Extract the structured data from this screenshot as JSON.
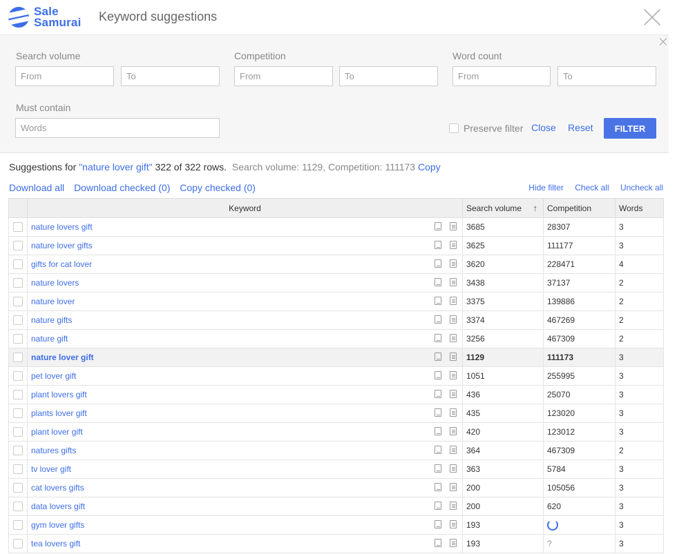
{
  "header": {
    "logo_line1": "Sale",
    "logo_line2": "Samurai",
    "title": "Keyword suggestions"
  },
  "filter": {
    "search_volume_label": "Search volume",
    "competition_label": "Competition",
    "word_count_label": "Word count",
    "must_contain_label": "Must contain",
    "from_placeholder": "From",
    "to_placeholder": "To",
    "words_placeholder": "Words",
    "preserve_label": "Preserve filter",
    "close_label": "Close",
    "reset_label": "Reset",
    "filter_button": "FILTER"
  },
  "summary": {
    "prefix": "Suggestions for",
    "query": "\"nature lover gift\"",
    "rows": "322 of 322 rows.",
    "stats": "Search volume: 1129, Competition: 111173",
    "copy_link": "Copy"
  },
  "actions": {
    "download_all": "Download all",
    "download_checked": "Download checked (0)",
    "copy_checked": "Copy checked (0)",
    "hide_filter": "Hide filter",
    "check_all": "Check all",
    "uncheck_all": "Uncheck all"
  },
  "table": {
    "columns": {
      "keyword": "Keyword",
      "search_volume": "Search volume",
      "competition": "Competition",
      "words": "Words"
    },
    "rows": [
      {
        "keyword": "nature lovers gift",
        "volume": "3685",
        "competition": "28307",
        "words": "3"
      },
      {
        "keyword": "nature lover gifts",
        "volume": "3625",
        "competition": "111177",
        "words": "3"
      },
      {
        "keyword": "gifts for cat lover",
        "volume": "3620",
        "competition": "228471",
        "words": "4"
      },
      {
        "keyword": "nature lovers",
        "volume": "3438",
        "competition": "37137",
        "words": "2"
      },
      {
        "keyword": "nature lover",
        "volume": "3375",
        "competition": "139886",
        "words": "2"
      },
      {
        "keyword": "nature gifts",
        "volume": "3374",
        "competition": "467269",
        "words": "2"
      },
      {
        "keyword": "nature gift",
        "volume": "3256",
        "competition": "467309",
        "words": "2"
      },
      {
        "keyword": "nature lover gift",
        "volume": "1129",
        "competition": "111173",
        "words": "3",
        "highlight": true
      },
      {
        "keyword": "pet lover gift",
        "volume": "1051",
        "competition": "255995",
        "words": "3"
      },
      {
        "keyword": "plant lovers gift",
        "volume": "436",
        "competition": "25070",
        "words": "3"
      },
      {
        "keyword": "plants lover gift",
        "volume": "435",
        "competition": "123020",
        "words": "3"
      },
      {
        "keyword": "plant lover gift",
        "volume": "420",
        "competition": "123012",
        "words": "3"
      },
      {
        "keyword": "natures gifts",
        "volume": "364",
        "competition": "467309",
        "words": "2"
      },
      {
        "keyword": "tv lover gift",
        "volume": "363",
        "competition": "5784",
        "words": "3"
      },
      {
        "keyword": "cat lovers gifts",
        "volume": "200",
        "competition": "105056",
        "words": "3"
      },
      {
        "keyword": "data lovers gift",
        "volume": "200",
        "competition": "620",
        "words": "3"
      },
      {
        "keyword": "gym lover gifts",
        "volume": "193",
        "competition": "",
        "competition_state": "loading",
        "words": "3"
      },
      {
        "keyword": "tea lovers gift",
        "volume": "193",
        "competition": "?",
        "competition_state": "unknown",
        "words": "3"
      }
    ]
  },
  "colors": {
    "accent": "#3d6ee8",
    "filter_button": "#4a74e6",
    "highlight_row": "#f2f2f2"
  },
  "icons": [
    "logo-icon",
    "close-icon",
    "copy-icon",
    "document-icon",
    "sort-arrow-icon",
    "spinner-icon",
    "checkbox-icon"
  ]
}
